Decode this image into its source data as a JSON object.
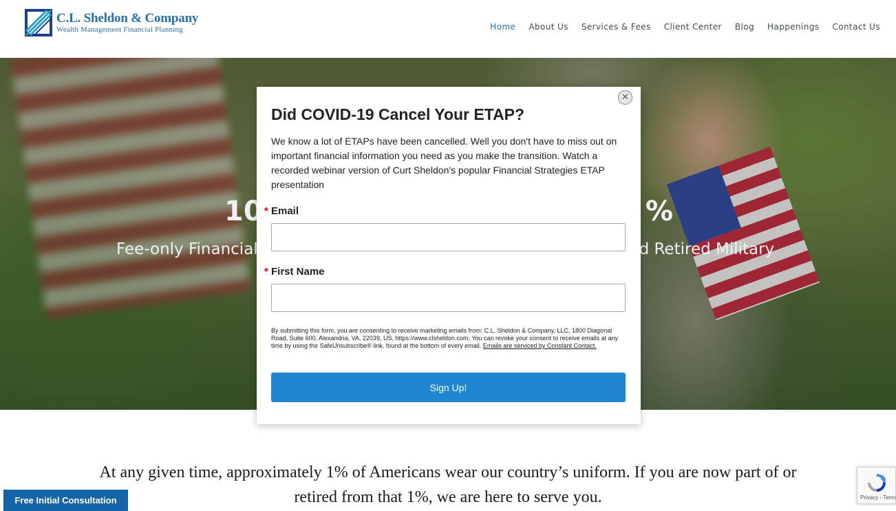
{
  "header": {
    "logo": {
      "name": "C.L. Sheldon & Company",
      "tagline": "Wealth Management Financial Planning"
    },
    "nav": [
      {
        "label": "Home",
        "active": true
      },
      {
        "label": "About Us",
        "active": false
      },
      {
        "label": "Services & Fees",
        "active": false
      },
      {
        "label": "Client Center",
        "active": false
      },
      {
        "label": "Blog",
        "active": false
      },
      {
        "label": "Happenings",
        "active": false
      },
      {
        "label": "Contact Us",
        "active": false
      }
    ]
  },
  "hero": {
    "headline_left": "10",
    "headline_right": "%",
    "sub_left": "Fee-only Financial",
    "sub_right": "nd Retired Military"
  },
  "modal": {
    "title": "Did COVID-19 Cancel Your ETAP?",
    "description": "We know a lot of ETAPs have been cancelled. Well you don't have to miss out on important financial information you need as you make the transition. Watch a recorded webinar version of Curt Sheldon's popular Financial Strategies ETAP presentation",
    "required_marker": "*",
    "email_label": "Email",
    "email_value": "",
    "first_name_label": "First Name",
    "first_name_value": "",
    "consent_text": "By submitting this form, you are consenting to receive marketing emails from: C.L. Sheldon & Company, LLC, 1800 Diagonal Road, Suite 600, Alexandria, VA, 22039, US, https://www.clsheldon.com. You can revoke your consent to receive emails at any time by using the SafeUnsubscribe® link, found at the bottom of every email.",
    "consent_link": "Emails are serviced by Constant Contact.",
    "submit_label": "Sign Up!",
    "close_glyph": "✕"
  },
  "tagline": {
    "line1": "At any given time, approximately 1% of Americans wear our country’s uniform. If you are now part of or",
    "line2": "retired from that 1%, we are here to serve you."
  },
  "consult_button": "Free Initial Consultation",
  "recaptcha": {
    "links": "Privacy - Terms"
  },
  "colors": {
    "nav_active": "#1e74c8",
    "signup_button": "#1f86d1",
    "consult_button": "#1465a8",
    "required": "#d0021b"
  }
}
